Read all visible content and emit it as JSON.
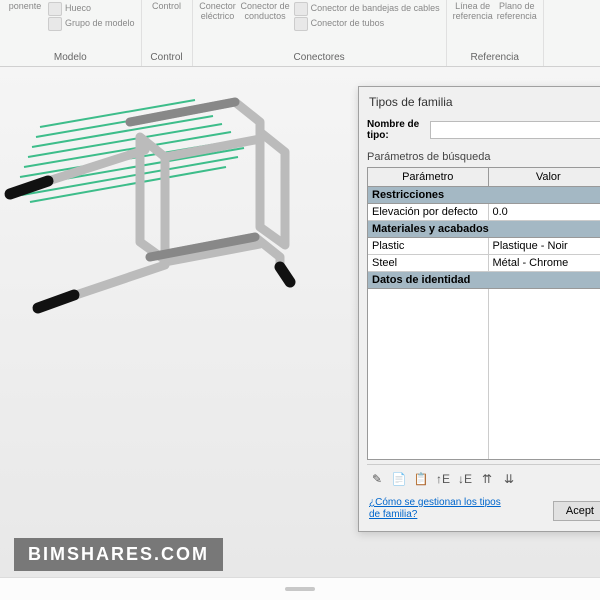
{
  "ribbon": {
    "groups": [
      {
        "label": "Modelo",
        "items": [
          {
            "label": "ponente",
            "name": "component-button"
          },
          {
            "stack": [
              {
                "label": "Hueco",
                "name": "hollow-button"
              },
              {
                "label": "Grupo de modelo",
                "name": "model-group-button"
              }
            ]
          }
        ]
      },
      {
        "label": "Control",
        "items": [
          {
            "label": "Control",
            "name": "control-button"
          }
        ]
      },
      {
        "label": "Conectores",
        "items": [
          {
            "label": "Conector\neléctrico",
            "name": "electrical-connector-button"
          },
          {
            "label": "Conector de\nconductos",
            "name": "duct-connector-button"
          },
          {
            "stack": [
              {
                "label": "Conector de bandejas de cables",
                "name": "cable-tray-connector-button"
              },
              {
                "label": "Conector de tubos",
                "name": "pipe-connector-button"
              }
            ]
          }
        ]
      },
      {
        "label": "Referencia",
        "items": [
          {
            "label": "Línea de\nreferencia",
            "name": "reference-line-button"
          },
          {
            "label": "Plano de\nreferencia",
            "name": "reference-plane-button"
          }
        ]
      }
    ]
  },
  "dialog": {
    "title": "Tipos de familia",
    "type_name_label": "Nombre de tipo:",
    "search_label": "Parámetros de búsqueda",
    "col_param": "Parámetro",
    "col_value": "Valor",
    "sections": [
      {
        "title": "Restricciones",
        "rows": [
          {
            "param": "Elevación por defecto",
            "value": "0.0"
          }
        ]
      },
      {
        "title": "Materiales y acabados",
        "rows": [
          {
            "param": "Plastic",
            "value": "Plastique - Noir"
          },
          {
            "param": "Steel",
            "value": "Métal - Chrome"
          }
        ]
      },
      {
        "title": "Datos de identidad",
        "rows": []
      }
    ],
    "help_link": "¿Cómo se gestionan los tipos de familia?",
    "accept_label": "Acept"
  },
  "watermark": "BIMSHARES.COM",
  "tool_icons": [
    "pencil-icon",
    "new-type-icon",
    "copy-type-icon",
    "sort-asc-icon",
    "sort-desc-icon",
    "move-up-icon",
    "move-down-icon"
  ],
  "tool_glyphs": [
    "✎",
    "📄",
    "📋",
    "↑E",
    "↓E",
    "⇈",
    "⇊"
  ]
}
